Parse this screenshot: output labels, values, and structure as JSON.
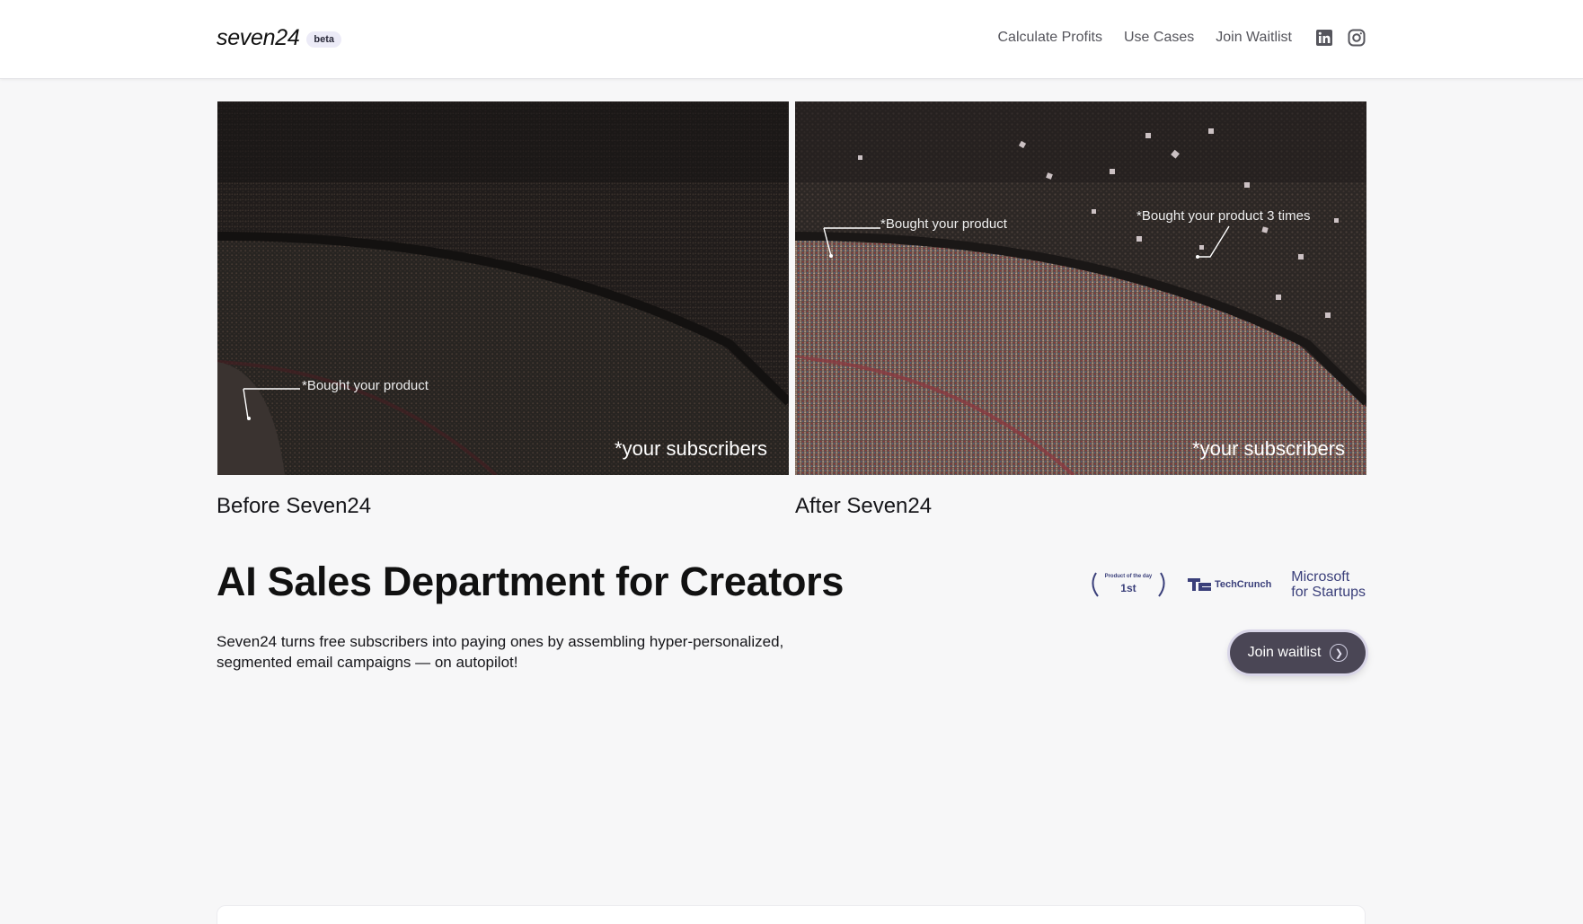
{
  "brand": {
    "name": "seven24",
    "badge": "beta"
  },
  "nav": {
    "links": [
      "Calculate Profits",
      "Use Cases",
      "Join Waitlist"
    ],
    "social_icons": [
      "linkedin-icon",
      "instagram-icon"
    ]
  },
  "comparison": {
    "before": {
      "annotation": "*Bought your product",
      "overlay": "*your subscribers",
      "caption": "Before Seven24"
    },
    "after": {
      "annotation_1": "*Bought your product",
      "annotation_2": "*Bought your product 3 times",
      "overlay": "*your subscribers",
      "caption": "After Seven24"
    }
  },
  "hero": {
    "title": "AI Sales Department for Creators",
    "subtitle": "Seven24 turns free subscribers into paying ones by assembling hyper-personalized, segmented email campaigns — on autopilot!",
    "cta_label": "Join waitlist"
  },
  "badges": {
    "product_hunt_top": "Product of the day",
    "product_hunt_rank": "1st",
    "techcrunch": "TechCrunch",
    "microsoft_line1": "Microsoft",
    "microsoft_line2": "for Startups"
  },
  "colors": {
    "background": "#f7f7f8",
    "cta": "#4a4655",
    "badge_accent": "#3a3f7a"
  }
}
